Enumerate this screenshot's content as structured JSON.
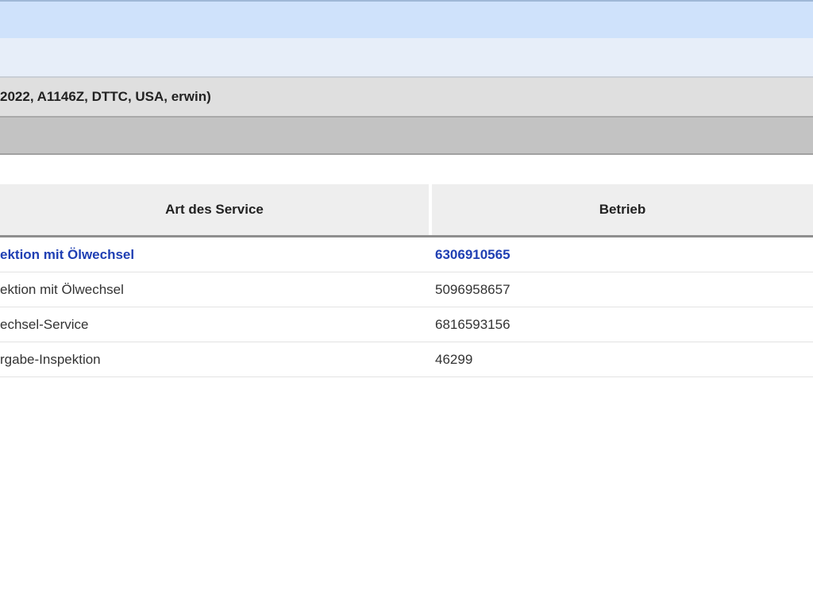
{
  "vehicle_info": "2022, A1146Z, DTTC, USA, erwin)",
  "table": {
    "headers": [
      "Art des Service",
      "Betrieb"
    ],
    "rows": [
      {
        "service": "ektion mit Ölwechsel",
        "betrieb": "6306910565"
      },
      {
        "service": "ektion mit Ölwechsel",
        "betrieb": "5096958657"
      },
      {
        "service": "echsel-Service",
        "betrieb": "6816593156"
      },
      {
        "service": "rgabe-Inspektion",
        "betrieb": "46299"
      }
    ]
  }
}
